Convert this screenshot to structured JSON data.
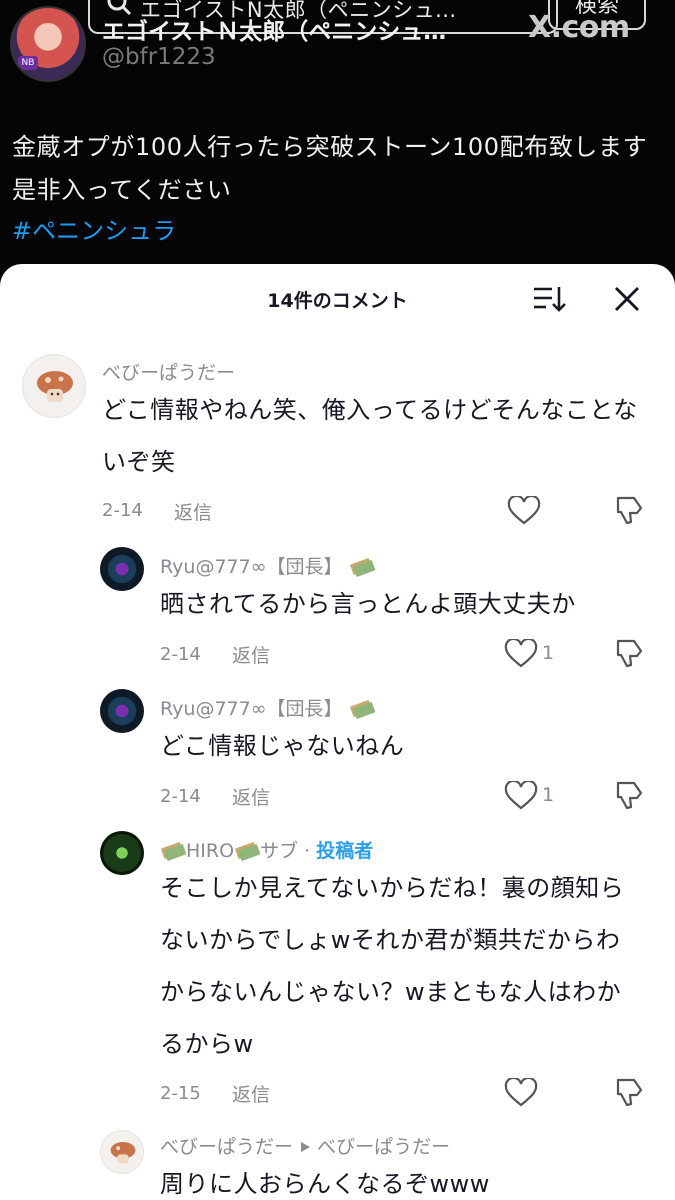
{
  "header": {
    "search_text": "エゴイストN太郎（ペニンシュ...",
    "search_button": "検索",
    "profile_name": "エゴイストＮ太郎（ペニンシュ…",
    "profile_handle": "@bfr1223",
    "watermark": "X.com",
    "avatar_badge": "NB"
  },
  "tweet": {
    "text": "金蔵オプが100人行ったら突破ストーン100配布致します是非入ってください",
    "hashtag": "#ペニンシュラ"
  },
  "comments_panel": {
    "title": "14件のコメント"
  },
  "comments": [
    {
      "username": "べびーぱうだー",
      "text": "どこ情報やねん笑、俺入ってるけどそんなことないぞ笑",
      "date": "2-14",
      "reply_label": "返信",
      "likes": ""
    },
    {
      "username": "Ryu@777∞【団長】",
      "text": "晒されてるから言っとんよ頭大丈夫か",
      "date": "2-14",
      "reply_label": "返信",
      "likes": "1"
    },
    {
      "username": "Ryu@777∞【団長】",
      "text": "どこ情報じゃないねん",
      "date": "2-14",
      "reply_label": "返信",
      "likes": "1"
    },
    {
      "username": "HIRO",
      "username_suffix": "サブ",
      "author_tag": "投稿者",
      "separator": "·",
      "text": "そこしか見えてないからだね！裏の顔知らないからでしょwそれか君が類共だからわからないんじゃない？wまともな人はわかるからw",
      "date": "2-15",
      "reply_label": "返信",
      "likes": ""
    },
    {
      "username": "べびーぱうだー",
      "reply_to": "べびーぱうだー",
      "text": "周りに人おらんくなるぞwww"
    }
  ],
  "colors": {
    "accent_blue": "#1d9bf0",
    "author_tag": "#2ba0e8",
    "text_primary": "#161823",
    "text_secondary": "#8a8b91"
  },
  "icons": [
    "search-icon",
    "sort-icon",
    "close-icon",
    "heart-icon",
    "dislike-icon",
    "money-icon",
    "play-arrow-icon"
  ]
}
